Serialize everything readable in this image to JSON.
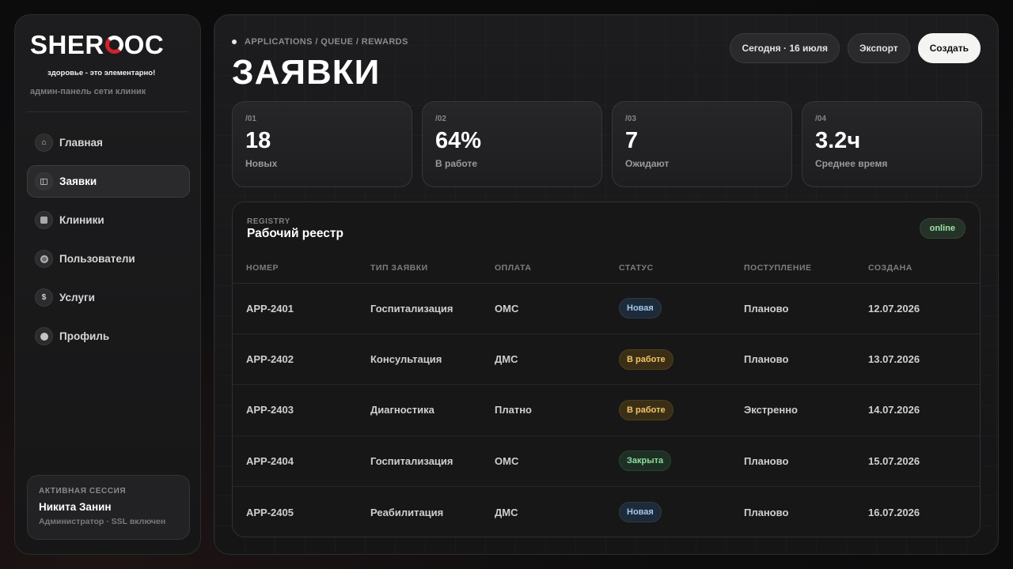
{
  "brand": {
    "logo_prefix": "SHER",
    "logo_suffix": "OC",
    "tagline": "здоровье - это элементарно!",
    "subtitle": "админ-панель сети клиник"
  },
  "sidebar": {
    "items": [
      {
        "label": "Главная",
        "icon": "home-icon",
        "active": false
      },
      {
        "label": "Заявки",
        "icon": "applications-icon",
        "active": true
      },
      {
        "label": "Клиники",
        "icon": "clinic-icon",
        "active": false
      },
      {
        "label": "Пользователи",
        "icon": "users-icon",
        "active": false
      },
      {
        "label": "Услуги",
        "icon": "dollar-icon",
        "active": false
      },
      {
        "label": "Профиль",
        "icon": "profile-icon",
        "active": false
      }
    ],
    "session": {
      "title": "АКТИВНАЯ СЕССИЯ",
      "name": "Никита Занин",
      "role": "Администратор · SSL включен"
    }
  },
  "header": {
    "breadcrumb": "APPLICATIONS / QUEUE / REWARDS",
    "title": "ЗАЯВКИ",
    "date_button": "Сегодня · 16 июля",
    "export_button": "Экспорт",
    "create_button": "Создать"
  },
  "stats": [
    {
      "index": "/01",
      "value": "18",
      "label": "Новых"
    },
    {
      "index": "/02",
      "value": "64%",
      "label": "В работе"
    },
    {
      "index": "/03",
      "value": "7",
      "label": "Ожидают"
    },
    {
      "index": "/04",
      "value": "3.2ч",
      "label": "Среднее время"
    }
  ],
  "registry": {
    "kicker": "REGISTRY",
    "title": "Рабочий реестр",
    "status_badge": "online",
    "columns": [
      "НОМЕР",
      "ТИП ЗАЯВКИ",
      "ОПЛАТА",
      "СТАТУС",
      "ПОСТУПЛЕНИЕ",
      "СОЗДАНА"
    ],
    "rows": [
      {
        "id": "APP-2401",
        "type": "Госпитализация",
        "payment": "ОМС",
        "status": "Новая",
        "status_kind": "new",
        "intake": "Планово",
        "created": "12.07.2026"
      },
      {
        "id": "APP-2402",
        "type": "Консультация",
        "payment": "ДМС",
        "status": "В работе",
        "status_kind": "work",
        "intake": "Планово",
        "created": "13.07.2026"
      },
      {
        "id": "APP-2403",
        "type": "Диагностика",
        "payment": "Платно",
        "status": "В работе",
        "status_kind": "work",
        "intake": "Экстренно",
        "created": "14.07.2026"
      },
      {
        "id": "APP-2404",
        "type": "Госпитализация",
        "payment": "ОМС",
        "status": "Закрыта",
        "status_kind": "closed",
        "intake": "Планово",
        "created": "15.07.2026"
      },
      {
        "id": "APP-2405",
        "type": "Реабилитация",
        "payment": "ДМС",
        "status": "Новая",
        "status_kind": "new",
        "intake": "Планово",
        "created": "16.07.2026"
      }
    ]
  },
  "colors": {
    "accent_red": "#d2232a",
    "status_new": "#9ec7f2",
    "status_work": "#f2c36a",
    "status_closed": "#8fdba0"
  }
}
